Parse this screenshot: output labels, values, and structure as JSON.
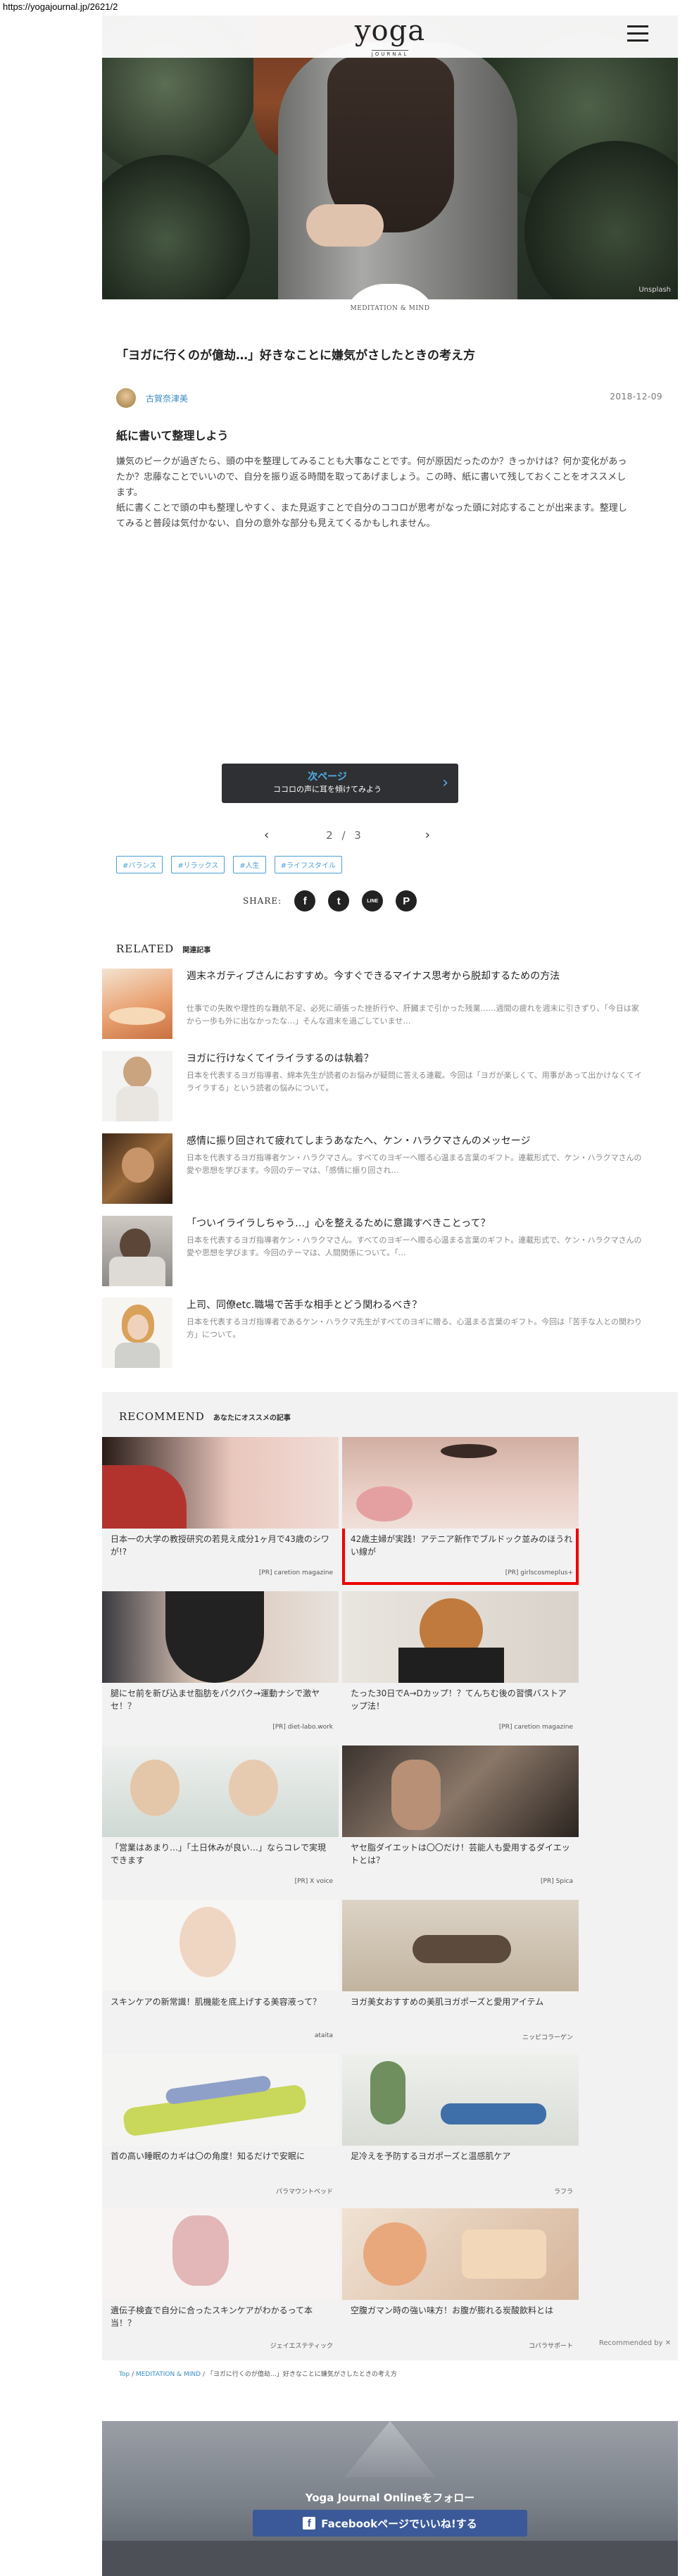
{
  "browser": {
    "url": "https://yogajournal.jp/2621/2"
  },
  "header": {
    "logo": "yoga",
    "logo_sub": "JOURNAL"
  },
  "hero": {
    "credit": "Unsplash"
  },
  "article": {
    "category": "MEDITATION & MIND",
    "title": "「ヨガに行くのが億劫…」好きなことに嫌気がさしたときの考え方",
    "author": "古賀奈津美",
    "date": "2018-12-09",
    "subhead": "紙に書いて整理しよう",
    "body_1": "嫌気のピークが過ぎたら、頭の中を整理してみることも大事なことです。何が原因だったのか？きっかけは？何か変化があったか？忠藤なことでいいので、自分を振り返る時間を取ってあげましょう。この時、紙に書いて残しておくことをオススメします。",
    "body_2": "紙に書くことで頭の中も整理しやすく、また見返すことで自分のココロが思考がなった頭に対応することが出来ます。整理してみると普段は気付かない、自分の意外な部分も見えてくるかもしれません。"
  },
  "next": {
    "label": "次ページ",
    "sub": "ココロの声に耳を傾けてみよう",
    "arrow": "›"
  },
  "pager": {
    "prev": "‹",
    "text": "2 / 3",
    "next": "›"
  },
  "tags": [
    "#バランス",
    "#リラックス",
    "#人生",
    "#ライフスタイル"
  ],
  "share": {
    "label": "SHARE:",
    "icons": [
      "f",
      "t",
      "LINE",
      "P"
    ]
  },
  "related": {
    "heading": "RELATED",
    "sub": "関連記事",
    "items": [
      {
        "title": "週末ネガティブさんにおすすめ。今すぐできるマイナス思考から脱却するための方法",
        "desc": "仕事での失敗や理性的な難航不足、必死に頑張った挫折行や、肝臓まで引かった残業……週間の疲れを週末に引きずり、「今日は家から一歩も外に出なかったな…」そんな週末を過ごしていませ…"
      },
      {
        "title": "ヨガに行けなくてイライラするのは執着？",
        "desc": "日本を代表するヨガ指導者、綿本先生が読者のお悩みが疑問に答える連載。今回は「ヨガが楽しくて、用事があって出かけなくてイライラする」という読者の悩みについて。"
      },
      {
        "title": "感情に振り回されて疲れてしまうあなたへ、ケン・ハラクマさんのメッセージ",
        "desc": "日本を代表するヨガ指導者ケン・ハラクマさん。すべてのヨギーへ贈る心温まる言葉のギフト。連載形式で、ケン・ハラクマさんの愛や思想を学びます。今回のテーマは、「感情に振り回され…"
      },
      {
        "title": "「ついイライラしちゃう…」心を整えるために意識すべきことって？",
        "desc": "日本を代表するヨガ指導者ケン・ハラクマさん。すべてのヨギーへ贈る心温まる言葉のギフト。連載形式で、ケン・ハラクマさんの愛や思想を学びます。今回のテーマは、人間関係について。「…"
      },
      {
        "title": "上司、同僚etc.職場で苦手な相手とどう関わるべき？",
        "desc": "日本を代表するヨガ指導者であるケン・ハラクマ先生がすべてのヨギに贈る、心温まる言葉のギフト。今回は「苦手な人との関わり方」について。"
      }
    ]
  },
  "recommend": {
    "heading": "RECOMMEND",
    "sub": "あなたにオススメの記事",
    "by": "Recommended by",
    "cards": [
      {
        "title": "日本一の大学の教授研究の若見え成分1ヶ月で43歳のシワが!?",
        "src": "[PR] caretion magazine"
      },
      {
        "title": "42歳主婦が実践！アテニア新作でブルドック並みのほうれい線が",
        "src": "[PR] girlscosmeplus+"
      },
      {
        "title": "腿にセ前を新び込ませ脂肪をパクパク→運動ナシで激ヤセ！？",
        "src": "[PR] diet-labo.work"
      },
      {
        "title": "たった30日でA→Dカップ！？てんちむ後の習慣バストアップ法！",
        "src": "[PR] caretion magazine"
      },
      {
        "title": "「営業はあまり…」「土日休みが良い…」ならコレで実現できます",
        "src": "[PR] X voice"
      },
      {
        "title": "ヤセ脂ダイエットは〇〇だけ！芸能人も愛用するダイエットとは？",
        "src": "[PR] Spica"
      },
      {
        "title": "スキンケアの新常識！肌機能を底上げする美容液って？",
        "src": "ataita"
      },
      {
        "title": "ヨガ美女おすすめの美肌ヨガポーズと愛用アイテム",
        "src": "ニッピコラーゲン"
      },
      {
        "title": "首の高い睡眠のカギは〇の角度！知るだけで安眠に",
        "src": "パラマウントベッド"
      },
      {
        "title": "足冷えを予防するヨガポーズと温感肌ケア",
        "src": "ラフラ"
      },
      {
        "title": "遺伝子検査で自分に合ったスキンケアがわかるって本当！？",
        "src": "ジェイエステティック"
      },
      {
        "title": "空腹ガマン時の強い味方！お腹が膨れる炭酸飲料とは",
        "src": "コバラサポート"
      }
    ]
  },
  "breadcrumb": {
    "home": "Top",
    "sep": "/",
    "cat": "MEDITATION & MIND",
    "current": "「ヨガに行くのが億劫…」好きなことに嫌気がさしたときの考え方"
  },
  "follow": {
    "text": "Yoga Journal Onlineをフォロー",
    "button": "Facebookページでいいね!する"
  }
}
